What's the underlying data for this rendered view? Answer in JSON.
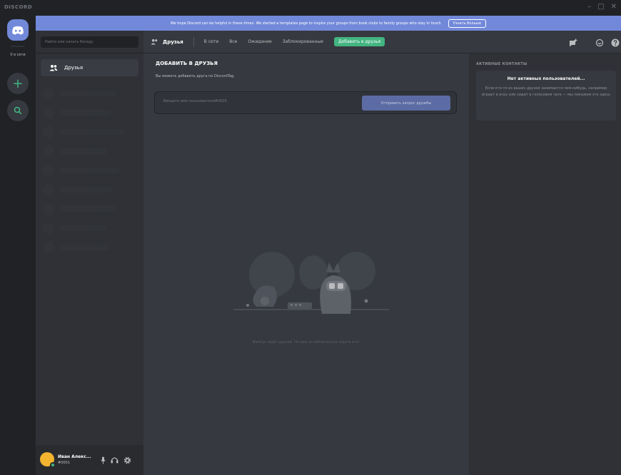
{
  "app": {
    "brand": "DISCORD",
    "window_controls": [
      "–",
      "□",
      "✕"
    ]
  },
  "notice": {
    "message": "We hope Discord can be helpful in these times. We started a templates page to inspire your groups from book clubs to family groups who stay in touch",
    "button": "Узнать больше"
  },
  "guilds": {
    "online_label": "0 в сети"
  },
  "sidebar": {
    "search_placeholder": "Найти или начать беседу",
    "friends_label": "Друзья"
  },
  "user": {
    "name": "Иван Алекс...",
    "tag": "#0001"
  },
  "topbar": {
    "title": "Друзья",
    "tabs": [
      "В сети",
      "Все",
      "Ожидание",
      "Заблокированные"
    ],
    "add_friend": "Добавить в друзья"
  },
  "add_friend": {
    "title": "ДОБАВИТЬ В ДРУЗЬЯ",
    "description": "Вы можете добавить друга по DiscordTag.",
    "placeholder": "Введите имя пользователя#0000",
    "button": "Отправить запрос дружбы"
  },
  "empty_state": {
    "text": "Вампус ждёт друзей. Но вам не обязательно ждать его!"
  },
  "active_now": {
    "title": "АКТИВНЫЕ КОНТАКТЫ",
    "empty_title": "Нет активных пользователей...",
    "empty_desc": "Если кто-то из ваших друзей занимается чем-нибудь, например играет в игру или сидит в голосовом чате — мы покажем это здесь"
  },
  "colors": {
    "blurple": "#7289da",
    "green": "#43b581",
    "bg_primary": "#36393f",
    "bg_secondary": "#2f3136",
    "bg_tertiary": "#202225"
  }
}
